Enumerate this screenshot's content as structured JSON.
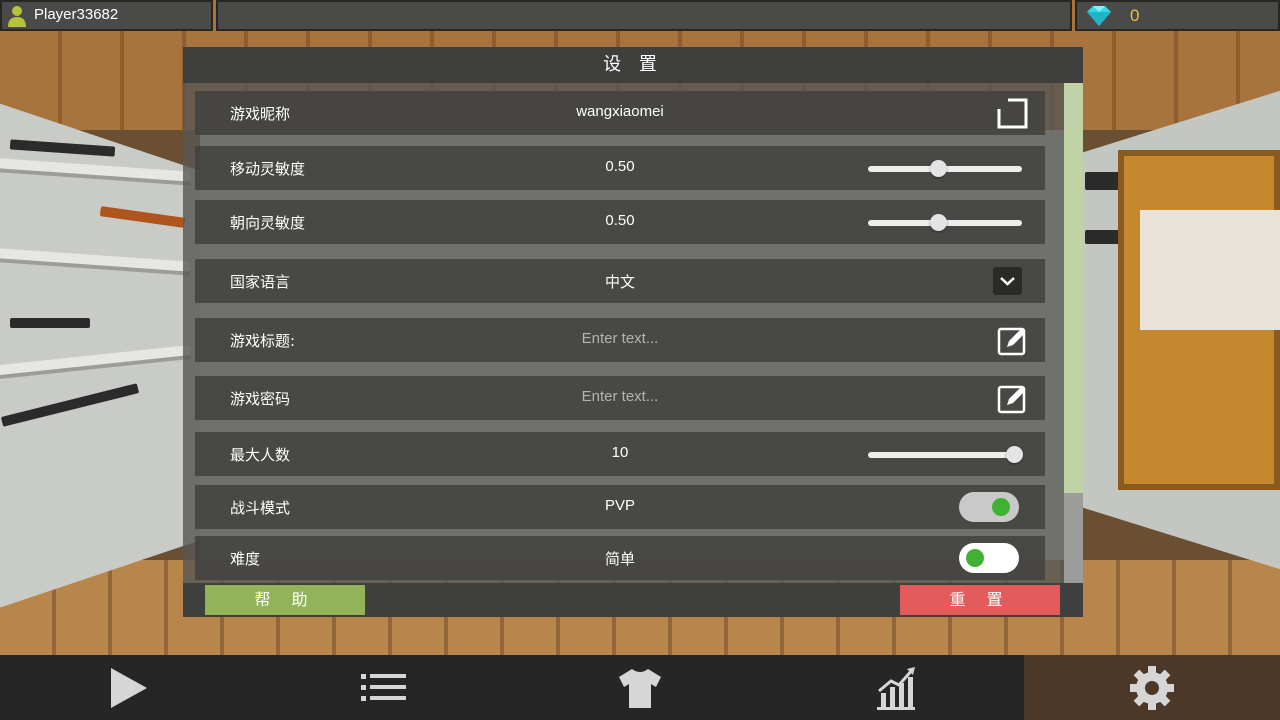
{
  "topbar": {
    "player_name": "Player33682",
    "gem_count": "0"
  },
  "settings": {
    "title": "设 置",
    "rows": [
      {
        "label": "游戏昵称",
        "value": "wangxiaomei",
        "control": "edit-box-icon"
      },
      {
        "label": "移动灵敏度",
        "value": "0.50",
        "control": "slider",
        "level": 0.46
      },
      {
        "label": "朝向灵敏度",
        "value": "0.50",
        "control": "slider",
        "level": 0.46
      },
      {
        "label": "国家语言",
        "value": "中文",
        "control": "dropdown"
      },
      {
        "label": "游戏标题:",
        "placeholder": "Enter text...",
        "control": "edit-icon"
      },
      {
        "label": "游戏密码",
        "placeholder": "Enter text...",
        "control": "edit-icon"
      },
      {
        "label": "最大人数",
        "value": "10",
        "control": "slider",
        "level": 0.95
      },
      {
        "label": "战斗模式",
        "value": "PVP",
        "control": "toggle",
        "state": "on"
      },
      {
        "label": "难度",
        "value": "简单",
        "control": "toggle",
        "state": "off"
      }
    ],
    "scroll_fraction": 0.82,
    "help_label": "帮 助",
    "reset_label": "重 置"
  },
  "nav": {
    "items": [
      {
        "name": "play",
        "icon": "play-icon"
      },
      {
        "name": "list",
        "icon": "list-icon"
      },
      {
        "name": "skin",
        "icon": "tshirt-icon"
      },
      {
        "name": "stats",
        "icon": "stats-chart-icon"
      },
      {
        "name": "settings",
        "icon": "gear-icon",
        "active": true
      }
    ]
  },
  "colors": {
    "help": "#93b359",
    "reset": "#e35b5a",
    "gem_count": "#e8c23a",
    "toggle_knob": "#3fb133",
    "nav_active": "#4b3829"
  }
}
